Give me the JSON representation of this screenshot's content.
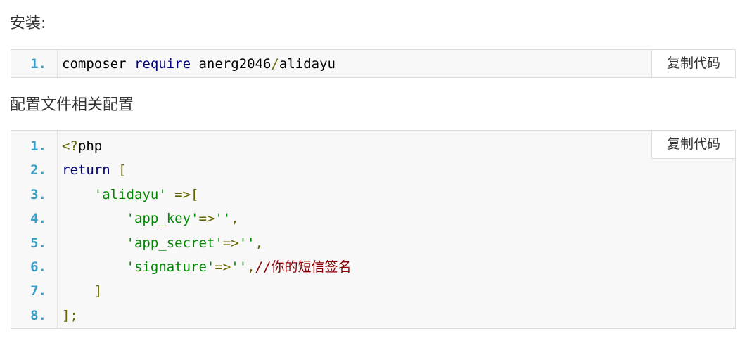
{
  "install": {
    "heading": "安装:",
    "copy_label": "复制代码",
    "lines": [
      {
        "num": "1.",
        "tokens": [
          {
            "t": "composer ",
            "c": "plain"
          },
          {
            "t": "require",
            "c": "kw"
          },
          {
            "t": " anerg2046",
            "c": "plain"
          },
          {
            "t": "/",
            "c": "punct"
          },
          {
            "t": "alidayu",
            "c": "plain"
          }
        ]
      }
    ]
  },
  "config": {
    "heading": "配置文件相关配置",
    "copy_label": "复制代码",
    "lines": [
      {
        "num": "1.",
        "tokens": [
          {
            "t": "<?",
            "c": "punct"
          },
          {
            "t": "php",
            "c": "plain"
          }
        ]
      },
      {
        "num": "2.",
        "tokens": [
          {
            "t": "return",
            "c": "kw"
          },
          {
            "t": " ",
            "c": "plain"
          },
          {
            "t": "[",
            "c": "punct"
          }
        ]
      },
      {
        "num": "3.",
        "tokens": [
          {
            "t": "    ",
            "c": "plain"
          },
          {
            "t": "'alidayu'",
            "c": "str"
          },
          {
            "t": " ",
            "c": "plain"
          },
          {
            "t": "=>[",
            "c": "punct"
          }
        ]
      },
      {
        "num": "4.",
        "tokens": [
          {
            "t": "        ",
            "c": "plain"
          },
          {
            "t": "'app_key'",
            "c": "str"
          },
          {
            "t": "=>",
            "c": "punct"
          },
          {
            "t": "''",
            "c": "str"
          },
          {
            "t": ",",
            "c": "punct"
          }
        ]
      },
      {
        "num": "5.",
        "tokens": [
          {
            "t": "        ",
            "c": "plain"
          },
          {
            "t": "'app_secret'",
            "c": "str"
          },
          {
            "t": "=>",
            "c": "punct"
          },
          {
            "t": "''",
            "c": "str"
          },
          {
            "t": ",",
            "c": "punct"
          }
        ]
      },
      {
        "num": "6.",
        "tokens": [
          {
            "t": "        ",
            "c": "plain"
          },
          {
            "t": "'signature'",
            "c": "str"
          },
          {
            "t": "=>",
            "c": "punct"
          },
          {
            "t": "''",
            "c": "str"
          },
          {
            "t": ",",
            "c": "punct"
          },
          {
            "t": "//你的短信签名",
            "c": "com"
          }
        ]
      },
      {
        "num": "7.",
        "tokens": [
          {
            "t": "    ",
            "c": "plain"
          },
          {
            "t": "]",
            "c": "punct"
          }
        ]
      },
      {
        "num": "8.",
        "tokens": [
          {
            "t": "];",
            "c": "punct"
          }
        ]
      }
    ]
  },
  "colors": {
    "line_number": "#3a9fc8",
    "keyword": "#000080",
    "string": "#008800",
    "punctuation": "#666600",
    "comment": "#880000",
    "code_background": "#f8f8f8"
  }
}
